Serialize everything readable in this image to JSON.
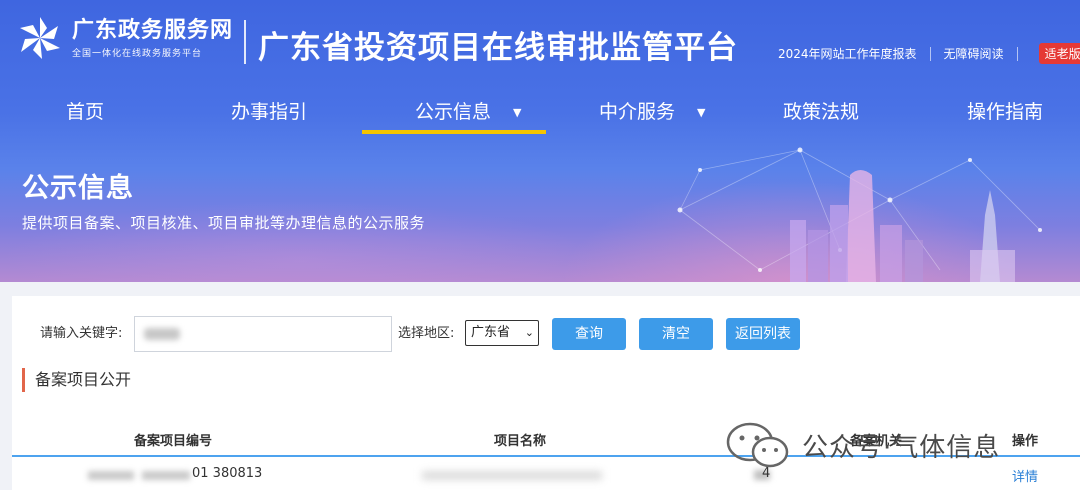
{
  "header": {
    "brand_name": "广东政务服务网",
    "brand_sub": "全国一体化在线政务服务平台",
    "platform_title": "广东省投资项目在线审批监管平台",
    "top_links": {
      "annual_report": "2024年网站工作年度报表",
      "accessible": "无障碍阅读",
      "elder_mode": "适老版"
    }
  },
  "nav": {
    "items": [
      {
        "label": "首页"
      },
      {
        "label": "办事指引"
      },
      {
        "label": "公示信息",
        "caret": "▼"
      },
      {
        "label": "中介服务",
        "caret": "▼"
      },
      {
        "label": "政策法规"
      },
      {
        "label": "操作指南"
      }
    ],
    "active": "公示信息"
  },
  "banner": {
    "title": "公示信息",
    "subtitle": "提供项目备案、项目核准、项目审批等办理信息的公示服务"
  },
  "search": {
    "keyword_label": "请输入关键字:",
    "region_label": "选择地区:",
    "region_value": "广东省",
    "query_btn": "查询",
    "clear_btn": "清空",
    "back_btn": "返回列表"
  },
  "section": {
    "title": "备案项目公开"
  },
  "table": {
    "headers": {
      "code": "备案项目编号",
      "name": "项目名称",
      "org": "备案机关",
      "op": "操作"
    },
    "rows": [
      {
        "code_tail": "01  380813",
        "org_tail": "4",
        "op": "详情"
      }
    ]
  },
  "watermark": {
    "text": "公众号·气体信息"
  },
  "colors": {
    "header_blue": "#4a72e6",
    "nav_active": "#f5c400",
    "button_blue": "#3d9be9",
    "section_accent": "#e2664a",
    "elder_red": "#e53935",
    "link_blue": "#2a7fd6"
  }
}
